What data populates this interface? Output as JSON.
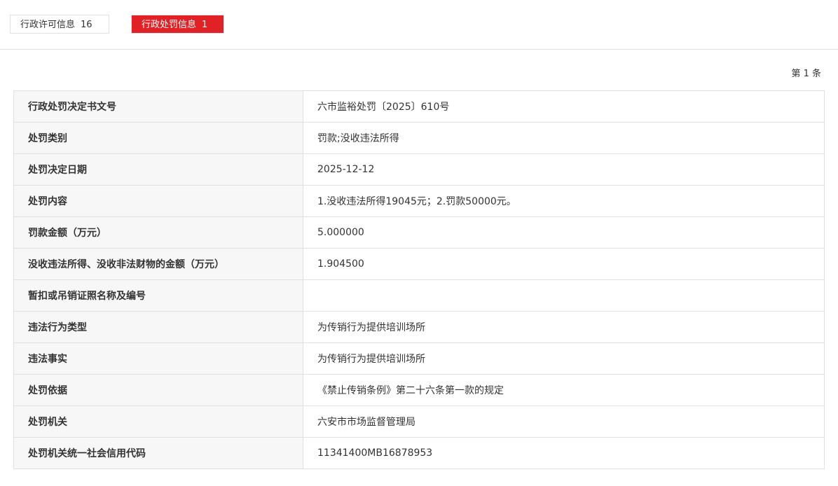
{
  "tabs": [
    {
      "label": "行政许可信息",
      "count": "16"
    },
    {
      "label": "行政处罚信息",
      "count": "1"
    }
  ],
  "pager": "第 1 条",
  "rows": [
    {
      "label": "行政处罚决定书文号",
      "value": "六市监裕处罚〔2025〕610号"
    },
    {
      "label": "处罚类别",
      "value": "罚款;没收违法所得"
    },
    {
      "label": "处罚决定日期",
      "value": "2025-12-12"
    },
    {
      "label": "处罚内容",
      "value": "1.没收违法所得19045元；2.罚款50000元。"
    },
    {
      "label": "罚款金额（万元）",
      "value": "5.000000"
    },
    {
      "label": "没收违法所得、没收非法财物的金额（万元）",
      "value": "1.904500"
    },
    {
      "label": "暂扣或吊销证照名称及编号",
      "value": ""
    },
    {
      "label": "违法行为类型",
      "value": "为传销行为提供培训场所"
    },
    {
      "label": "违法事实",
      "value": "为传销行为提供培训场所"
    },
    {
      "label": "处罚依据",
      "value": "《禁止传销条例》第二十六条第一款的规定"
    },
    {
      "label": "处罚机关",
      "value": "六安市市场监督管理局"
    },
    {
      "label": "处罚机关统一社会信用代码",
      "value": "11341400MB16878953"
    }
  ]
}
